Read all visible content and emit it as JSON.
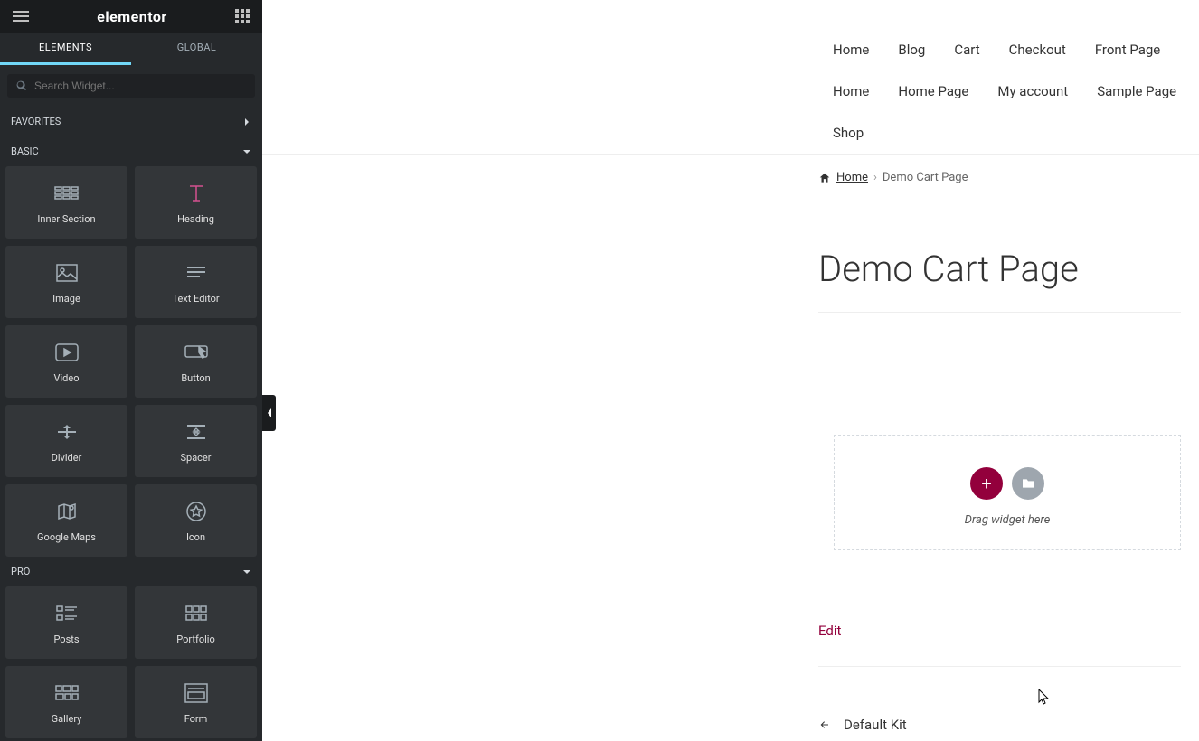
{
  "brand": "elementor",
  "tabs": {
    "elements": "ELEMENTS",
    "global": "GLOBAL"
  },
  "search": {
    "placeholder": "Search Widget..."
  },
  "sections": {
    "favorites": "FAVORITES",
    "basic": "BASIC",
    "pro": "PRO"
  },
  "widgets_basic": [
    {
      "label": "Inner Section",
      "icon": "inner-section"
    },
    {
      "label": "Heading",
      "icon": "heading"
    },
    {
      "label": "Image",
      "icon": "image"
    },
    {
      "label": "Text Editor",
      "icon": "text-editor"
    },
    {
      "label": "Video",
      "icon": "video"
    },
    {
      "label": "Button",
      "icon": "button"
    },
    {
      "label": "Divider",
      "icon": "divider"
    },
    {
      "label": "Spacer",
      "icon": "spacer"
    },
    {
      "label": "Google Maps",
      "icon": "google-maps"
    },
    {
      "label": "Icon",
      "icon": "icon"
    }
  ],
  "widgets_pro": [
    {
      "label": "Posts",
      "icon": "posts"
    },
    {
      "label": "Portfolio",
      "icon": "portfolio"
    },
    {
      "label": "Gallery",
      "icon": "gallery"
    },
    {
      "label": "Form",
      "icon": "form"
    }
  ],
  "nav": [
    "Home",
    "Blog",
    "Cart",
    "Checkout",
    "Front Page",
    "Home",
    "Home Page",
    "My account",
    "Sample Page",
    "Shop"
  ],
  "breadcrumb": {
    "home": "Home",
    "current": "Demo Cart Page"
  },
  "page": {
    "title": "Demo Cart Page"
  },
  "dropzone": {
    "hint": "Drag widget here"
  },
  "edit": "Edit",
  "prev": "Default Kit",
  "colors": {
    "accent": "#93003c",
    "heading_pink": "#d4508f",
    "tab_active": "#71d7f7"
  }
}
